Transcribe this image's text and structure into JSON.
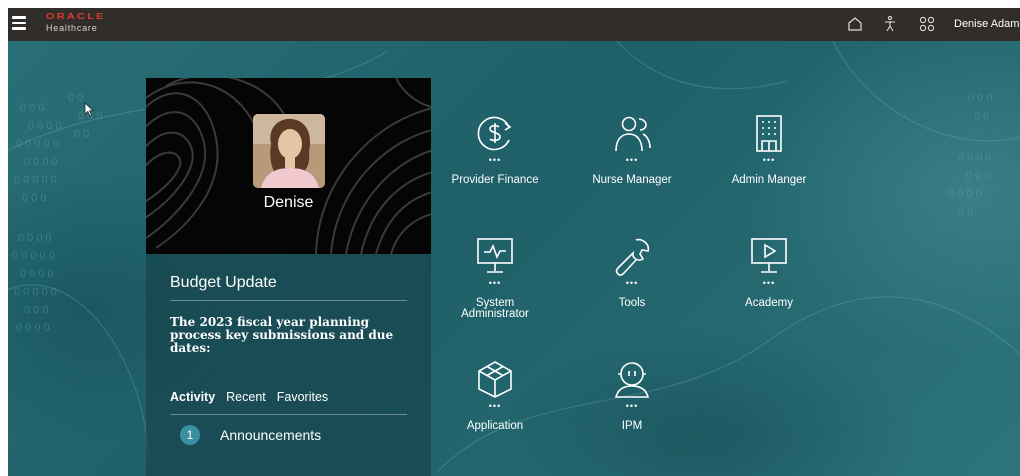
{
  "header": {
    "brand_name": "ORACLE",
    "brand_sub": "Healthcare",
    "brand_color": "#e03a2e",
    "icons": [
      "menu-icon",
      "home-icon",
      "accessibility-icon",
      "apps-grid-icon"
    ],
    "user_name": "Denise Adams"
  },
  "profile": {
    "name": "Denise"
  },
  "budget": {
    "title": "Budget Update",
    "body": "The 2023 fiscal year planning process  key submissions and due dates:"
  },
  "tabs": [
    {
      "label": "Activity",
      "active": true
    },
    {
      "label": "Recent",
      "active": false
    },
    {
      "label": "Favorites",
      "active": false
    }
  ],
  "announcements": {
    "count": "1",
    "label": "Announcements"
  },
  "apps": [
    {
      "label": "Provider Finance",
      "icon": "finance-icon",
      "dots": "•••"
    },
    {
      "label": "Nurse Manager",
      "icon": "users-icon",
      "dots": "•••"
    },
    {
      "label": "Admin Manger",
      "icon": "building-icon",
      "dots": "•••"
    },
    {
      "label": "System Administrator",
      "icon": "monitor-pulse-icon",
      "dots": "•••"
    },
    {
      "label": "Tools",
      "icon": "wrench-icon",
      "dots": "•••"
    },
    {
      "label": "Academy",
      "icon": "video-monitor-icon",
      "dots": "•••"
    },
    {
      "label": "Application",
      "icon": "cube-icon",
      "dots": "•••"
    },
    {
      "label": "IPM",
      "icon": "person-headset-icon",
      "dots": "•••"
    }
  ],
  "colors": {
    "topbar": "#312d2a",
    "background": "#2a6f77",
    "badge": "#3c8fa0"
  }
}
